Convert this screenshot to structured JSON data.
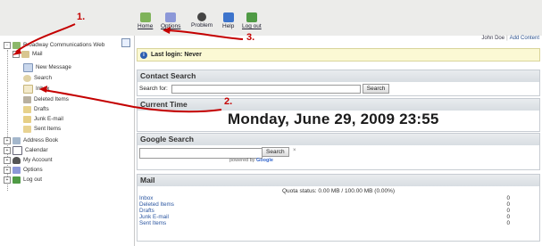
{
  "toolbar": {
    "items": [
      {
        "label": "Home",
        "icon": "home-icon",
        "color": "#5e9b3a"
      },
      {
        "label": "Options",
        "icon": "options-icon",
        "color": "#6f7fc8"
      },
      {
        "label": "Problem",
        "icon": "problem-icon",
        "color": "#333333"
      },
      {
        "label": "Help",
        "icon": "help-icon",
        "color": "#3a6fc4"
      },
      {
        "label": "Log out",
        "icon": "logout-icon",
        "color": "#3f8a3a"
      }
    ]
  },
  "user": {
    "name": "John Doe",
    "separator": "|",
    "add_content": "Add Content"
  },
  "sidebar": {
    "title": "Broadway Communications Web",
    "mail": "Mail",
    "mail_children": [
      "New Message",
      "Search",
      "Inbox",
      "Deleted Items",
      "Drafts",
      "Junk E-mail",
      "Sent Items"
    ],
    "other": [
      "Address Book",
      "Calendar",
      "My Account",
      "Options",
      "Log out"
    ]
  },
  "login": {
    "text": "Last login: Never"
  },
  "contact_search": {
    "title": "Contact Search",
    "label": "Search for:",
    "button": "Search"
  },
  "current_time": {
    "title": "Current Time",
    "value": "Monday, June 29, 2009 23:55"
  },
  "google_search": {
    "title": "Google Search",
    "button": "Search",
    "clear": "×",
    "powered_prefix": "powered by",
    "powered_brand": "Google"
  },
  "mail_panel": {
    "title": "Mail",
    "quota": "Quota status: 0.00 MB / 100.00 MB (0.00%)",
    "rows": [
      {
        "name": "Inbox",
        "count": "0"
      },
      {
        "name": "Deleted Items",
        "count": "0"
      },
      {
        "name": "Drafts",
        "count": "0"
      },
      {
        "name": "Junk E-mail",
        "count": "0"
      },
      {
        "name": "Sent Items",
        "count": "0"
      }
    ]
  },
  "annotations": {
    "one": "1.",
    "two": "2.",
    "three": "3.",
    "color": "#c40000"
  }
}
